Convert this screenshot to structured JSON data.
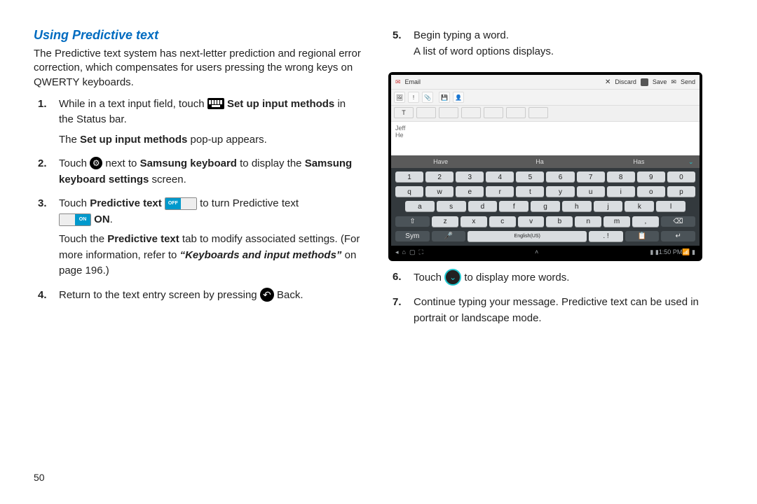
{
  "heading": "Using Predictive text",
  "intro": "The Predictive text system has next-letter prediction and regional error correction, which compensates for users pressing the wrong keys on QWERTY keyboards.",
  "steps": {
    "s1a": "While in a text input field, touch ",
    "s1b": " Set up input methods",
    "s1c": " in the Status bar.",
    "s1sub_a": "The ",
    "s1sub_b": "Set up input methods",
    "s1sub_c": " pop-up appears.",
    "s2a": "Touch ",
    "s2b": " next to ",
    "s2c": "Samsung keyboard",
    "s2d": " to display the ",
    "s2e": "Samsung keyboard settings",
    "s2f": " screen.",
    "s3a": "Touch ",
    "s3b": "Predictive text",
    "s3c": " to turn Predictive text ",
    "s3d": "ON",
    "s3e": ".",
    "s3sub_a": "Touch the ",
    "s3sub_b": "Predictive text",
    "s3sub_c": " tab to modify associated settings. (For more information, refer to ",
    "s3sub_d": "“Keyboards and input methods”",
    "s3sub_e": " on page 196.)",
    "s4a": "Return to the text entry screen by pressing ",
    "s4b": " Back.",
    "s5a": "Begin typing a word.",
    "s5b": "A list of word options displays.",
    "s6a": "Touch ",
    "s6b": " to display more words.",
    "s7": "Continue typing your message. Predictive text can be used in portrait or landscape mode."
  },
  "toggle_off": "OFF",
  "toggle_on_small": "ON",
  "pagenum": "50",
  "shot": {
    "app": "Email",
    "discard": "Discard",
    "save": "Save",
    "send": "Send",
    "typed1": "Jeff",
    "typed2": "He",
    "suggestions": [
      "Have",
      "Ha",
      "Has"
    ],
    "rows": {
      "num": [
        "1",
        "2",
        "3",
        "4",
        "5",
        "6",
        "7",
        "8",
        "9",
        "0"
      ],
      "r1": [
        "q",
        "w",
        "e",
        "r",
        "t",
        "y",
        "u",
        "i",
        "o",
        "p"
      ],
      "r2": [
        "a",
        "s",
        "d",
        "f",
        "g",
        "h",
        "j",
        "k",
        "l"
      ],
      "r3": [
        "z",
        "x",
        "c",
        "v",
        "b",
        "n",
        "m"
      ]
    },
    "shift": "⇧",
    "bksp": "⌫",
    "sym": "Sym",
    "mic": "🎤",
    "lang": "English(US)",
    "comma": ",",
    "period": ". !",
    "clip": "📋",
    "enter": "↵",
    "status_time": "1:50 PM"
  }
}
